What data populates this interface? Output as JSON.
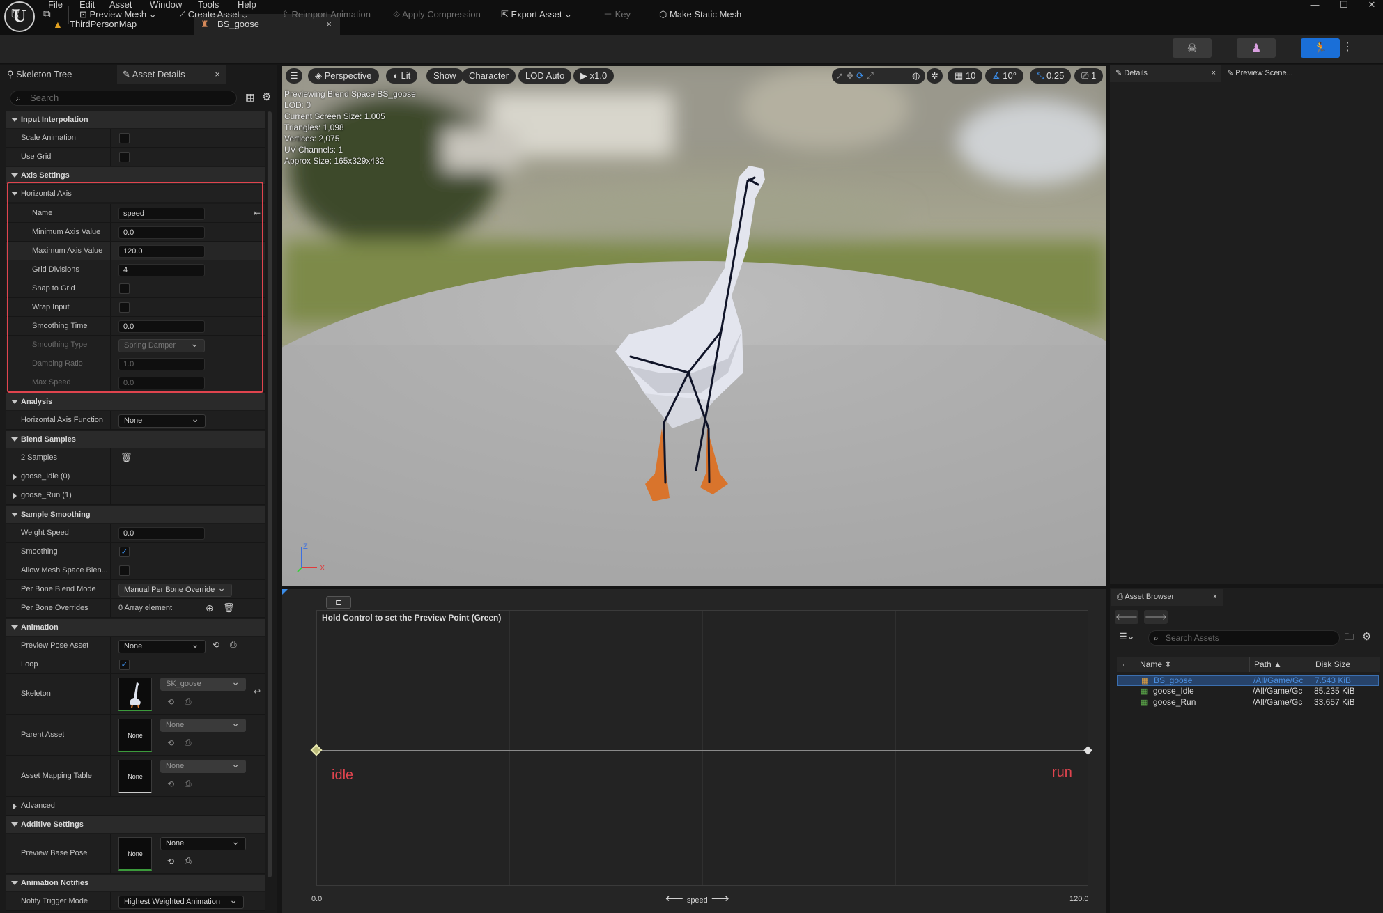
{
  "menu": {
    "file": "File",
    "edit": "Edit",
    "asset": "Asset",
    "window": "Window",
    "tools": "Tools",
    "help": "Help"
  },
  "tabs": {
    "map": "ThirdPersonMap",
    "asset": "BS_goose",
    "close": "×"
  },
  "window": {
    "minimize": "—",
    "maximize": "☐",
    "close": "✕"
  },
  "toolbar": {
    "preview_mesh": "Preview Mesh",
    "create_asset": "Create Asset",
    "reimport": "Reimport Animation",
    "apply_compression": "Apply Compression",
    "export_asset": "Export Asset",
    "key": "Key",
    "make_static_mesh": "Make Static Mesh"
  },
  "left_panel": {
    "tabs": {
      "skeleton_tree": "Skeleton Tree",
      "asset_details": "Asset Details",
      "close": "×"
    },
    "search_placeholder": "Search",
    "sections": {
      "input_interpolation": "Input Interpolation",
      "scale_animation": "Scale Animation",
      "use_grid": "Use Grid",
      "axis_settings": "Axis Settings",
      "horizontal_axis": "Horizontal Axis",
      "analysis": "Analysis",
      "blend_samples": "Blend Samples",
      "sample_smoothing": "Sample Smoothing",
      "animation": "Animation",
      "advanced": "Advanced",
      "additive_settings": "Additive Settings",
      "animation_notifies": "Animation Notifies"
    },
    "axis": {
      "name_label": "Name",
      "name_value": "speed",
      "min_label": "Minimum Axis Value",
      "min_value": "0.0",
      "max_label": "Maximum Axis Value",
      "max_value": "120.0",
      "grid_label": "Grid Divisions",
      "grid_value": "4",
      "snap_label": "Snap to Grid",
      "wrap_label": "Wrap Input",
      "smooth_time_label": "Smoothing Time",
      "smooth_time_value": "0.0",
      "smooth_type_label": "Smoothing Type",
      "smooth_type_value": "Spring Damper",
      "damping_label": "Damping Ratio",
      "damping_value": "1.0",
      "max_speed_label": "Max Speed",
      "max_speed_value": "0.0"
    },
    "analysis": {
      "label": "Horizontal Axis Function",
      "value": "None"
    },
    "blend_samples": {
      "count": "2 Samples",
      "items": [
        "goose_Idle (0)",
        "goose_Run (1)"
      ]
    },
    "sample_smoothing": {
      "weight_speed_label": "Weight Speed",
      "weight_speed_value": "0.0",
      "smoothing_label": "Smoothing",
      "allow_mesh_label": "Allow Mesh Space Blen...",
      "per_bone_mode_label": "Per Bone Blend Mode",
      "per_bone_mode_value": "Manual Per Bone Override",
      "per_bone_overrides_label": "Per Bone Overrides",
      "per_bone_overrides_value": "0 Array element"
    },
    "animation": {
      "preview_pose_label": "Preview Pose Asset",
      "preview_pose_value": "None",
      "loop_label": "Loop",
      "skeleton_label": "Skeleton",
      "skeleton_value": "SK_goose",
      "parent_label": "Parent Asset",
      "parent_value": "None",
      "parent_thumb": "None",
      "mapping_label": "Asset Mapping Table",
      "mapping_value": "None",
      "mapping_thumb": "None"
    },
    "additive": {
      "preview_base_label": "Preview Base Pose",
      "preview_base_value": "None",
      "preview_base_thumb": "None"
    },
    "notifies": {
      "trigger_label": "Notify Trigger Mode",
      "trigger_value": "Highest Weighted Animation"
    }
  },
  "viewport": {
    "perspective": "Perspective",
    "lit": "Lit",
    "show": "Show",
    "character": "Character",
    "lod": "LOD Auto",
    "play": "x1.0",
    "grid_size": "10",
    "angle": "10°",
    "scale": "0.25",
    "camera": "1",
    "stats": [
      "Previewing Blend Space BS_goose",
      "LOD: 0",
      "Current Screen Size: 1.005",
      "Triangles: 1,098",
      "Vertices: 2,075",
      "UV Channels: 1",
      "Approx Size: 165x329x432"
    ]
  },
  "blend_editor": {
    "hint": "Hold Control to set the Preview Point (Green)",
    "idle": "idle",
    "run": "run",
    "axis_min": "0.0",
    "axis_max": "120.0",
    "axis_name": "speed"
  },
  "right_panel": {
    "details": "Details",
    "preview_scene": "Preview Scene...",
    "close": "×",
    "asset_browser": "Asset Browser",
    "search_placeholder": "Search Assets",
    "columns": {
      "name": "Name",
      "path": "Path",
      "size": "Disk Size"
    },
    "assets": [
      {
        "name": "BS_goose",
        "path": "/All/Game/Gc",
        "size": "7.543 KiB"
      },
      {
        "name": "goose_Idle",
        "path": "/All/Game/Gc",
        "size": "85.235 KiB"
      },
      {
        "name": "goose_Run",
        "path": "/All/Game/Gc",
        "size": "33.657 KiB"
      }
    ]
  },
  "colors": {
    "highlight": "#e0444e",
    "accent": "#3b8eea",
    "active_mode": "#1a6fd8"
  }
}
